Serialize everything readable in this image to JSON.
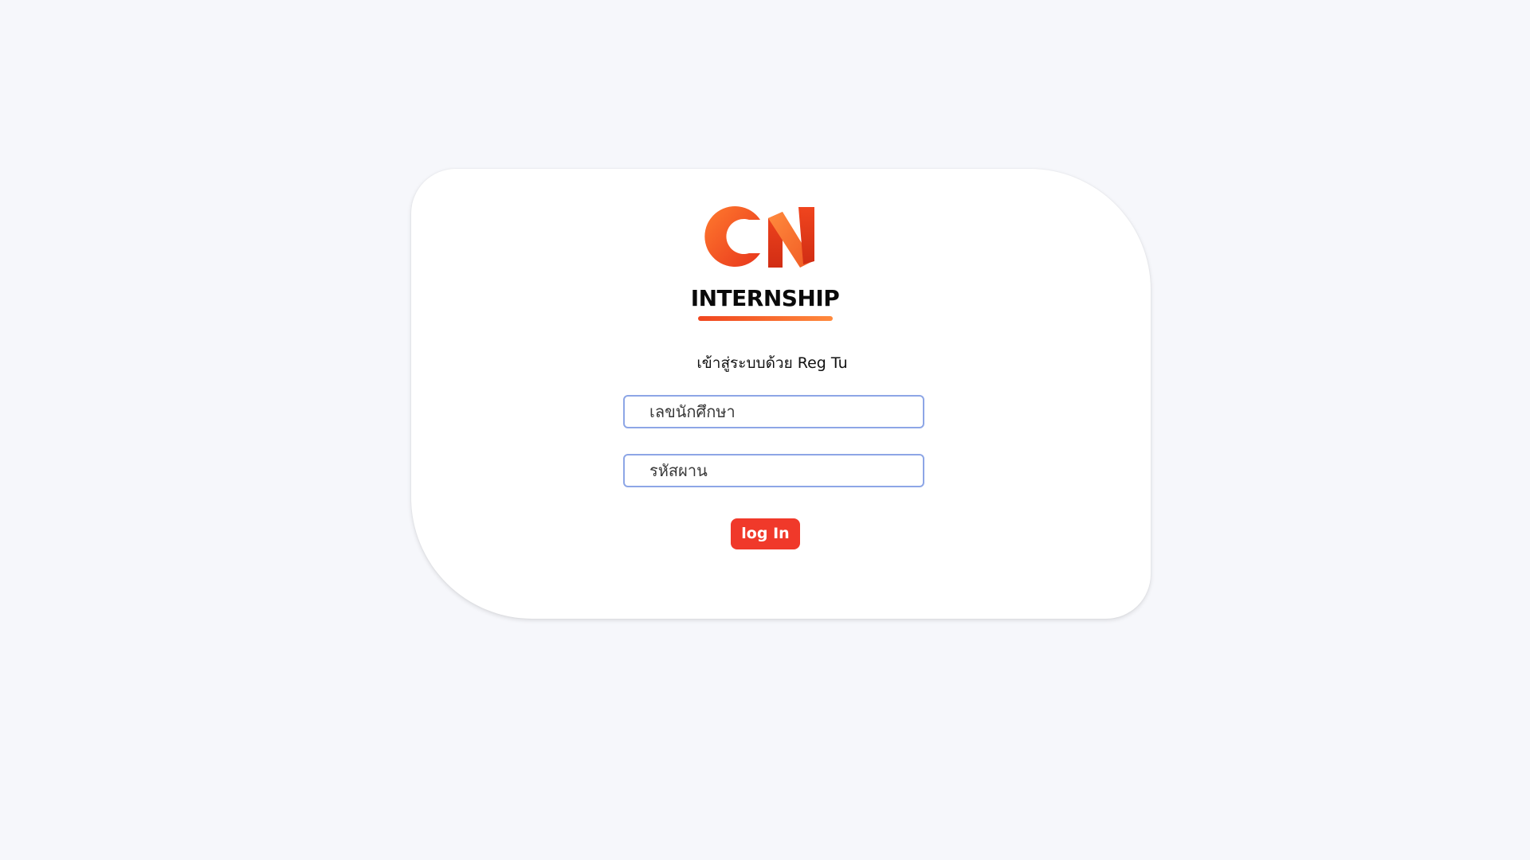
{
  "brand": {
    "logo_text": "CN",
    "title": "INTERNSHIP",
    "accent_color": "#f0451e"
  },
  "login": {
    "subtitle": "เข้าสู่ระบบด้วย Reg Tu",
    "student_id_placeholder": "เลขนักศึกษา",
    "password_placeholder": "รหัสผาน",
    "button_label": "log In",
    "button_color": "#f0392a"
  }
}
